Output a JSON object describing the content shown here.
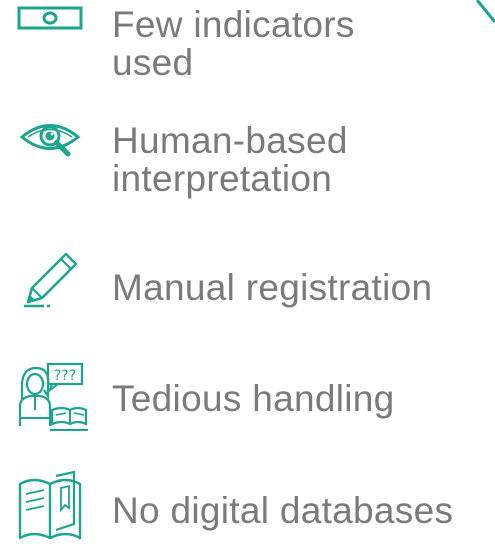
{
  "accent_color": "#1aa58f",
  "text_color": "#7a7a7a",
  "items": [
    {
      "icon": "banknote-icon",
      "line1": "Few indicators",
      "line2": "used"
    },
    {
      "icon": "eye-magnifier-icon",
      "line1": "Human-based",
      "line2": "interpretation"
    },
    {
      "icon": "pencil-icon",
      "line1": "Manual registration",
      "line2": ""
    },
    {
      "icon": "confused-person-icon",
      "line1": "Tedious handling",
      "line2": ""
    },
    {
      "icon": "open-book-icon",
      "line1": "No digital databases",
      "line2": ""
    }
  ]
}
